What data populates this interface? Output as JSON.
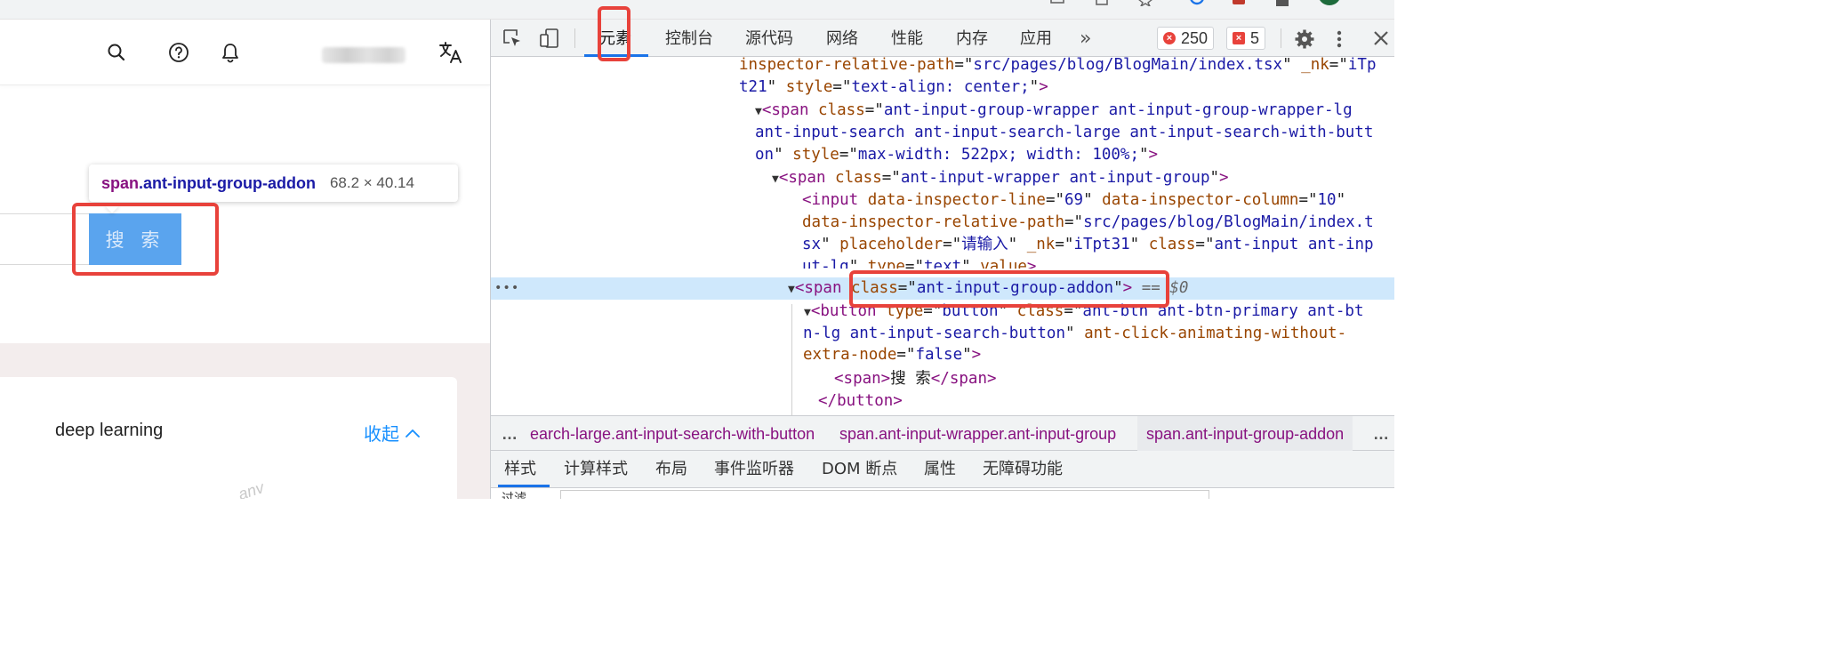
{
  "page": {
    "collapse_label": "收起",
    "card_label": "deep learning",
    "watermark": "anv",
    "search_button_label": "搜 索",
    "tooltip": {
      "tag": "span",
      "cls": ".ant-input-group-addon",
      "size": "68.2 × 40.14"
    }
  },
  "devtools": {
    "tabs": [
      {
        "label": "元素"
      },
      {
        "label": "控制台"
      },
      {
        "label": "源代码"
      },
      {
        "label": "网络"
      },
      {
        "label": "性能"
      },
      {
        "label": "内存"
      },
      {
        "label": "应用"
      }
    ],
    "more_label": "»",
    "errors_count": "250",
    "warnings_count": "5",
    "code_lines": {
      "l1": {
        "an1": "inspector-relative-path",
        "eq1": "=\"",
        "av1": "src/pages/blog/BlogMain/index.tsx",
        "q1": "\"",
        "an2": " _nk",
        "eq2": "=\"",
        "av2": "iTp"
      },
      "l2": {
        "av1": "t21",
        "q1": "\"",
        "an1": " style",
        "eq1": "=\"",
        "av2": "text-align: center;",
        "q2": "\"",
        "tg": ">"
      },
      "l3": {
        "tg": "<span",
        "an1": " class",
        "eq1": "=\"",
        "av1": "ant-input-group-wrapper ant-input-group-wrapper-lg"
      },
      "l4": {
        "av1": "ant-input-search ant-input-search-large ant-input-search-with-butt"
      },
      "l5": {
        "av1": "on",
        "q1": "\"",
        "an1": " style",
        "eq1": "=\"",
        "av2": "max-width: 522px; width: 100%;",
        "q2": "\"",
        "tg": ">"
      },
      "l6": {
        "tg": "<span",
        "an1": " class",
        "eq1": "=\"",
        "av1": "ant-input-wrapper ant-input-group",
        "q1": "\"",
        "tg2": ">"
      },
      "l7": {
        "tg": "<input",
        "an1": " data-inspector-line",
        "eq1": "=\"",
        "av1": "69",
        "q1": "\"",
        "an2": " data-inspector-column",
        "eq2": "=\"",
        "av2": "10",
        "q2": "\""
      },
      "l8": {
        "an1": "data-inspector-relative-path",
        "eq1": "=\"",
        "av1": "src/pages/blog/BlogMain/index.t"
      },
      "l9": {
        "av1": "sx",
        "q1": "\"",
        "an1": " placeholder",
        "eq1": "=\"",
        "av2": "请输入",
        "q2": "\"",
        "an2": " _nk",
        "eq2": "=\"",
        "av3": "iTpt31",
        "q3": "\"",
        "an3": " class",
        "eq3": "=\"",
        "av4": "ant-input ant-inp"
      },
      "l10": {
        "av1": "ut-lg",
        "q1": "\"",
        "an1": " type",
        "eq1": "=\"",
        "av2": "text",
        "q2": "\"",
        "an2": " value",
        "tg": ">"
      },
      "l11": {
        "tg": "<span",
        "an1": " class",
        "eq1": "=\"",
        "av1": "ant-input-group-addon",
        "q1": "\"",
        "tg2": ">",
        "eq0": " == $0"
      },
      "l12": {
        "tg": "<button",
        "an1": " type",
        "eq1": "=\"",
        "av1": "button",
        "q1": "\"",
        "an2": " class",
        "eq2": "=\"",
        "av2": "ant-btn ant-btn-primary ant-bt"
      },
      "l13": {
        "av1": "n-lg ant-input-search-button",
        "q1": "\"",
        "an1": " ant-click-animating-without-"
      },
      "l14": {
        "an1": "extra-node",
        "eq1": "=\"",
        "av1": "false",
        "q1": "\"",
        "tg": ">"
      },
      "l15": {
        "tg": "<span>",
        "tx": "搜 索",
        "tg2": "</span>"
      },
      "l16": {
        "tg": "</button>"
      }
    },
    "breadcrumbs": [
      {
        "label": "earch-large.ant-input-search-with-button"
      },
      {
        "label": "span.ant-input-wrapper.ant-input-group"
      },
      {
        "label": "span.ant-input-group-addon"
      }
    ],
    "sub_tabs": [
      {
        "label": "样式"
      },
      {
        "label": "计算样式"
      },
      {
        "label": "布局"
      },
      {
        "label": "事件监听器"
      },
      {
        "label": "DOM 断点"
      },
      {
        "label": "属性"
      },
      {
        "label": "无障碍功能"
      }
    ],
    "filter_label": "过滤"
  },
  "colors": {
    "highlight_red": "#e8423b",
    "active_blue": "#1a73e8",
    "button_blue": "#5aa4ee",
    "link_blue": "#1890ff",
    "tag_purple": "#881280",
    "attr_brown": "#994500",
    "value_navy": "#1a1aa6"
  }
}
